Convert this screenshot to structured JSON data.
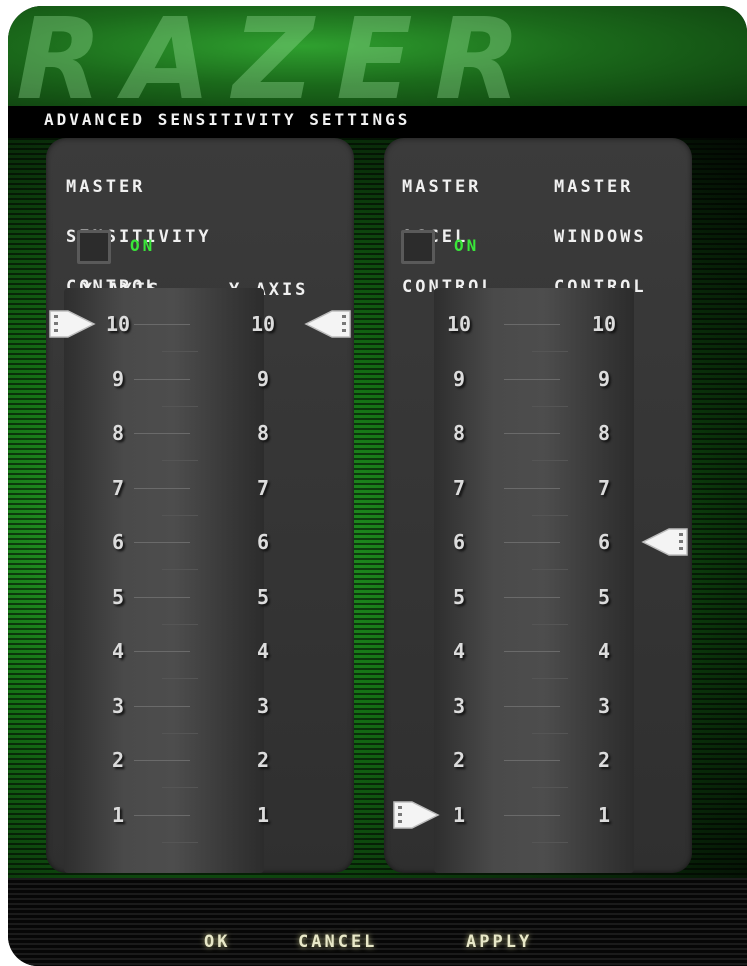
{
  "window": {
    "logo_text": "RAZER",
    "title": "Advanced Sensitivity Settings"
  },
  "left_panel": {
    "label_line1": "Master",
    "label_line2": "Sensitivity",
    "label_line3": "Control",
    "toggle_label": "on",
    "toggle_checked": false,
    "x_axis_label": "X-AXIS",
    "y_axis_label": "Y-AXIS",
    "x_axis_value": 10,
    "y_axis_value": 10
  },
  "right_panel": {
    "accel_line1": "Master",
    "accel_line2": "Accel",
    "accel_line3": "Control",
    "windows_line1": "Master",
    "windows_line2": "Windows",
    "windows_line3": "Control",
    "toggle_label": "on",
    "toggle_checked": false,
    "accel_value": 1,
    "windows_value": 6
  },
  "scale": [
    "10",
    "9",
    "8",
    "7",
    "6",
    "5",
    "4",
    "3",
    "2",
    "1"
  ],
  "buttons": {
    "ok": "Ok",
    "cancel": "Cancel",
    "apply": "Apply"
  },
  "colors": {
    "accent_green": "#39e639",
    "panel": "#3b3b3b",
    "frame": "#050505"
  }
}
